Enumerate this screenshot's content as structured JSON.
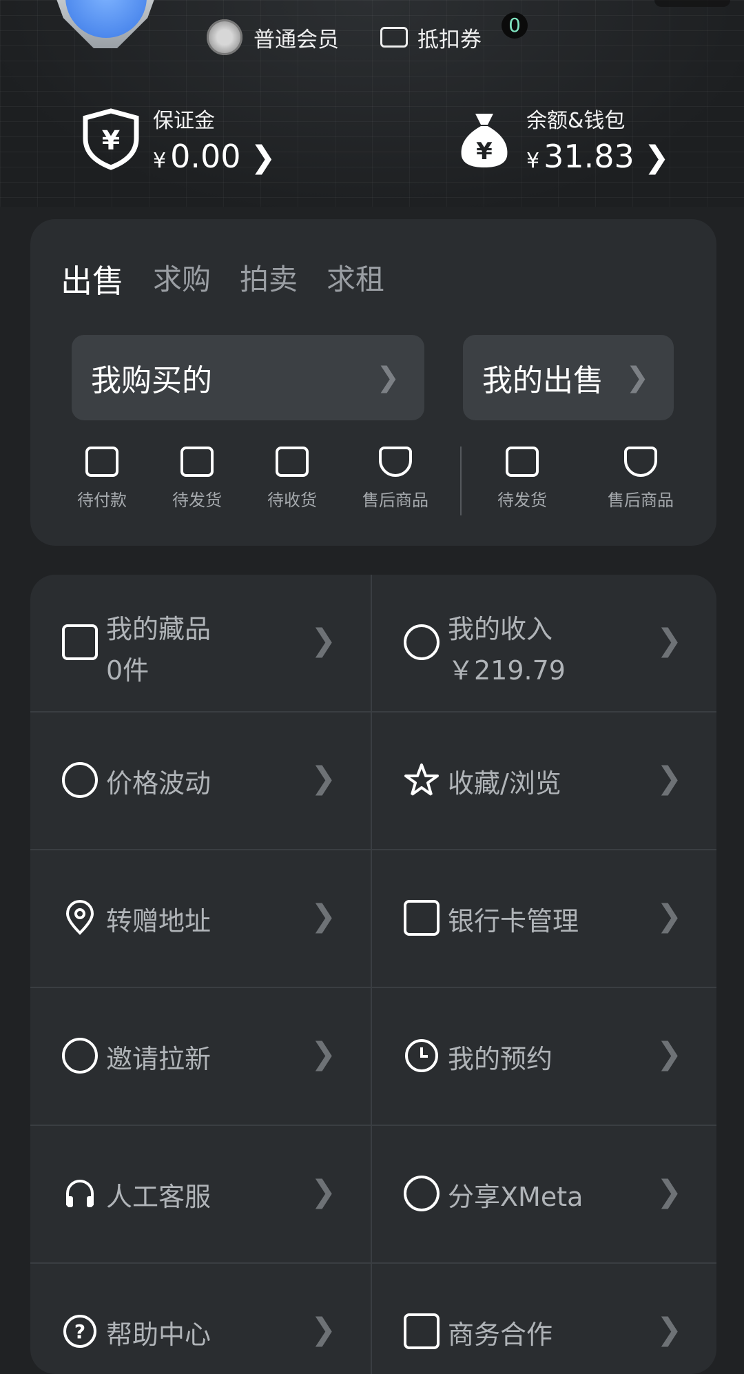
{
  "header": {
    "member_label": "普通会员",
    "coupon_label": "抵扣券",
    "coupon_count": "0"
  },
  "wallets": [
    {
      "label": "保证金",
      "currency": "¥",
      "amount": "0.00"
    },
    {
      "label": "余额&钱包",
      "currency": "¥",
      "amount": "31.83"
    }
  ],
  "orders": {
    "tabs": [
      "出售",
      "求购",
      "拍卖",
      "求租"
    ],
    "active_tab": "出售",
    "buy_button": "我购买的",
    "sell_button": "我的出售",
    "buy_status": [
      "待付款",
      "待发货",
      "待收货",
      "售后商品"
    ],
    "sell_status": [
      "待发货",
      "售后商品"
    ]
  },
  "menu": {
    "collection": {
      "label": "我的藏品",
      "value": "0件"
    },
    "income": {
      "label": "我的收入",
      "value": "￥219.79"
    },
    "price_trend": "价格波动",
    "favorites": "收藏/浏览",
    "address": "转赠地址",
    "bank_card": "银行卡管理",
    "invite": "邀请拉新",
    "reservation": "我的预约",
    "service": "人工客服",
    "share": "分享XMeta",
    "help": "帮助中心",
    "business": "商务合作"
  },
  "icons": {
    "member": "member-medal-icon",
    "coupon": "coupon-ticket-icon",
    "deposit": "shield-yen-icon",
    "wallet": "money-bag-icon"
  },
  "colors": {
    "background": "#202224",
    "card": "#2a2d30",
    "button": "#3c4044",
    "badge_text": "#7fe3c0"
  }
}
